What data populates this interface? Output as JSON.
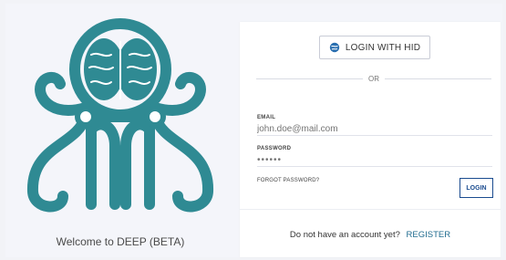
{
  "branding": {
    "welcome_text": "Welcome to DEEP (BETA)",
    "logo_color": "#2f8a93"
  },
  "login": {
    "hid_button_label": "LOGIN WITH HID",
    "hid_icon": "hid-globe-icon",
    "separator_text": "OR",
    "email_label": "EMAIL",
    "email_placeholder": "john.doe@mail.com",
    "password_label": "PASSWORD",
    "password_placeholder": "••••••",
    "forgot_label": "FORGOT PASSWORD?",
    "login_button_label": "LOGIN"
  },
  "register": {
    "prompt": "Do not have an account yet?",
    "link_label": "REGISTER"
  },
  "colors": {
    "accent": "#1a4b8f",
    "link": "#1f6b8f",
    "background": "#f4f5fa"
  }
}
